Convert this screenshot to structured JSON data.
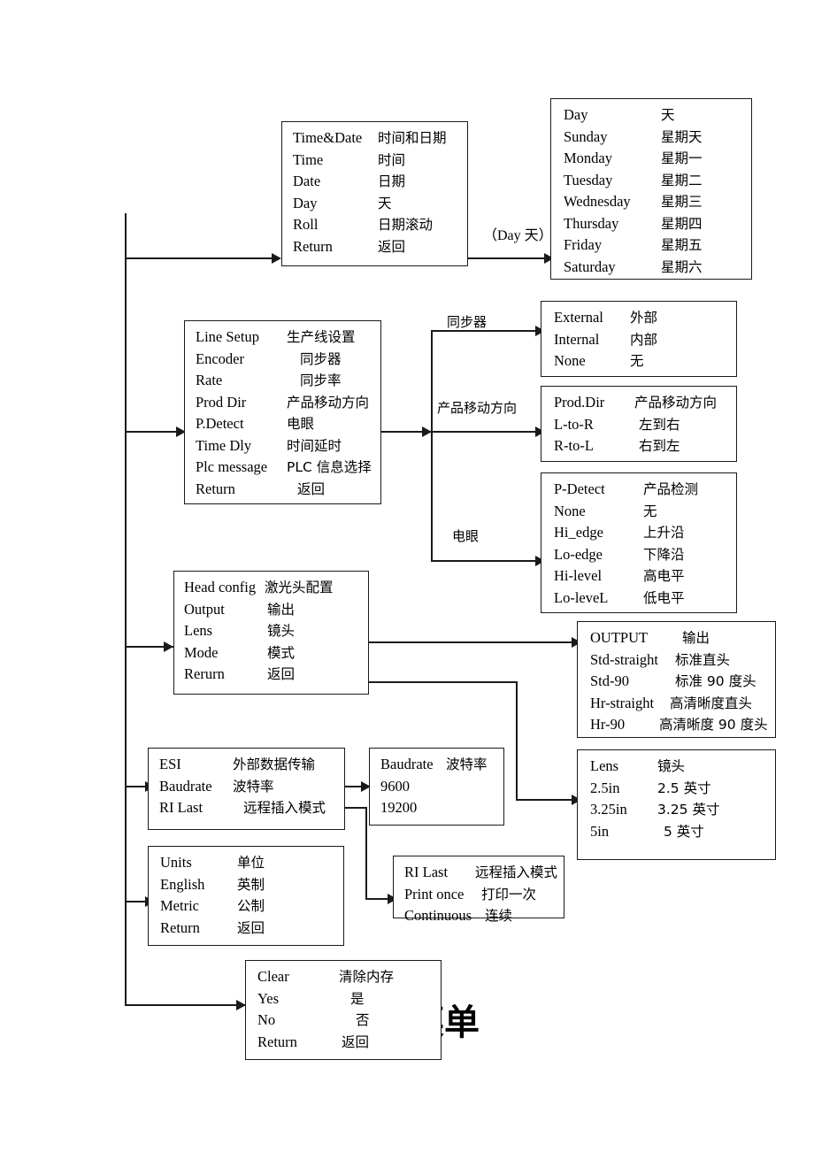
{
  "diagram": {
    "title_watermark": "菜单",
    "edge_labels": {
      "day": "（Day 天）",
      "encoder": "同步器",
      "prod_dir": "产品移动方向",
      "p_detect": "电眼"
    }
  },
  "boxes": {
    "time_date": {
      "name": "Time&Date menu",
      "rows": [
        {
          "en": "Time&Date",
          "cn": "时间和日期"
        },
        {
          "en": "Time",
          "cn": "时间"
        },
        {
          "en": "Date",
          "cn": "日期"
        },
        {
          "en": "Day",
          "cn": "天"
        },
        {
          "en": "Roll",
          "cn": "日期滚动"
        },
        {
          "en": "Return",
          "cn": "返回"
        }
      ]
    },
    "days": {
      "name": "Day options",
      "rows": [
        {
          "en": "Day",
          "cn": "天"
        },
        {
          "en": "Sunday",
          "cn": "星期天"
        },
        {
          "en": "Monday",
          "cn": "星期一"
        },
        {
          "en": "Tuesday",
          "cn": "星期二"
        },
        {
          "en": "Wednesday",
          "cn": "星期三"
        },
        {
          "en": "Thursday",
          "cn": "星期四"
        },
        {
          "en": "Friday",
          "cn": "星期五"
        },
        {
          "en": "Saturday",
          "cn": "星期六"
        }
      ]
    },
    "line_setup": {
      "name": "Line Setup menu",
      "rows": [
        {
          "en": "Line Setup",
          "cn": "生产线设置"
        },
        {
          "en": "Encoder",
          "cn": "同步器"
        },
        {
          "en": "Rate",
          "cn": "同步率"
        },
        {
          "en": "Prod Dir",
          "cn": "产品移动方向"
        },
        {
          "en": "P.Detect",
          "cn": "电眼"
        },
        {
          "en": "Time Dly",
          "cn": "时间延时"
        },
        {
          "en": "Plc message",
          "cn": "PLC 信息选择"
        },
        {
          "en": "Return",
          "cn": "返回"
        }
      ]
    },
    "encoder": {
      "name": "Encoder options",
      "rows": [
        {
          "en": "External",
          "cn": "外部"
        },
        {
          "en": "Internal",
          "cn": "内部"
        },
        {
          "en": "None",
          "cn": "无"
        }
      ]
    },
    "prod_dir": {
      "name": "Product direction options",
      "rows": [
        {
          "en": "Prod.Dir",
          "cn": "产品移动方向"
        },
        {
          "en": "L-to-R",
          "cn": "左到右"
        },
        {
          "en": "R-to-L",
          "cn": "右到左"
        }
      ]
    },
    "p_detect": {
      "name": "Product detect options",
      "rows": [
        {
          "en": "P-Detect",
          "cn": "产品检测"
        },
        {
          "en": "None",
          "cn": "无"
        },
        {
          "en": "Hi_edge",
          "cn": "上升沿"
        },
        {
          "en": "Lo-edge",
          "cn": "下降沿"
        },
        {
          "en": "Hi-level",
          "cn": "高电平"
        },
        {
          "en": "Lo-leveL",
          "cn": "低电平"
        }
      ]
    },
    "head_config": {
      "name": "Head config menu",
      "rows": [
        {
          "en": "Head config",
          "cn": "激光头配置"
        },
        {
          "en": "Output",
          "cn": "输出"
        },
        {
          "en": "Lens",
          "cn": "镜头"
        },
        {
          "en": "Mode",
          "cn": "模式"
        },
        {
          "en": "Rerurn",
          "cn": "返回"
        }
      ]
    },
    "output": {
      "name": "Output options",
      "rows": [
        {
          "en": "OUTPUT",
          "cn": "输出"
        },
        {
          "en": "Std-straight",
          "cn": "标准直头"
        },
        {
          "en": "Std-90",
          "cn": "标准 90 度头"
        },
        {
          "en": "Hr-straight",
          "cn": "高清晰度直头"
        },
        {
          "en": "Hr-90",
          "cn": "高清晰度 90 度头"
        }
      ]
    },
    "lens": {
      "name": "Lens options",
      "rows": [
        {
          "en": "Lens",
          "cn": "镜头"
        },
        {
          "en": "2.5in",
          "cn": "2.5 英寸"
        },
        {
          "en": "3.25in",
          "cn": "3.25 英寸"
        },
        {
          "en": "5in",
          "cn": "5 英寸"
        }
      ]
    },
    "esi": {
      "name": "ESI menu",
      "rows": [
        {
          "en": "ESI",
          "cn": "外部数据传输"
        },
        {
          "en": "Baudrate",
          "cn": "波特率"
        },
        {
          "en": "RI Last",
          "cn": "远程插入模式"
        }
      ]
    },
    "baudrate": {
      "name": "Baudrate options",
      "rows": [
        {
          "en": "Baudrate",
          "cn": "波特率"
        },
        {
          "en": "9600",
          "cn": ""
        },
        {
          "en": "19200",
          "cn": ""
        }
      ]
    },
    "units": {
      "name": "Units menu",
      "rows": [
        {
          "en": "Units",
          "cn": "单位"
        },
        {
          "en": "English",
          "cn": "英制"
        },
        {
          "en": "Metric",
          "cn": "公制"
        },
        {
          "en": " Return",
          "cn": "返回"
        }
      ]
    },
    "ri_last": {
      "name": "RI Last options",
      "rows": [
        {
          "en": "RI Last",
          "cn": "远程插入模式"
        },
        {
          "en": "Print once",
          "cn": "打印一次"
        },
        {
          "en": "Continuous",
          "cn": "连续"
        }
      ]
    },
    "clear": {
      "name": "Clear memory menu",
      "rows": [
        {
          "en": "Clear",
          "cn": "清除内存"
        },
        {
          "en": "Yes",
          "cn": "是"
        },
        {
          "en": "No",
          "cn": "否"
        },
        {
          "en": " Return",
          "cn": "返回"
        }
      ]
    }
  }
}
